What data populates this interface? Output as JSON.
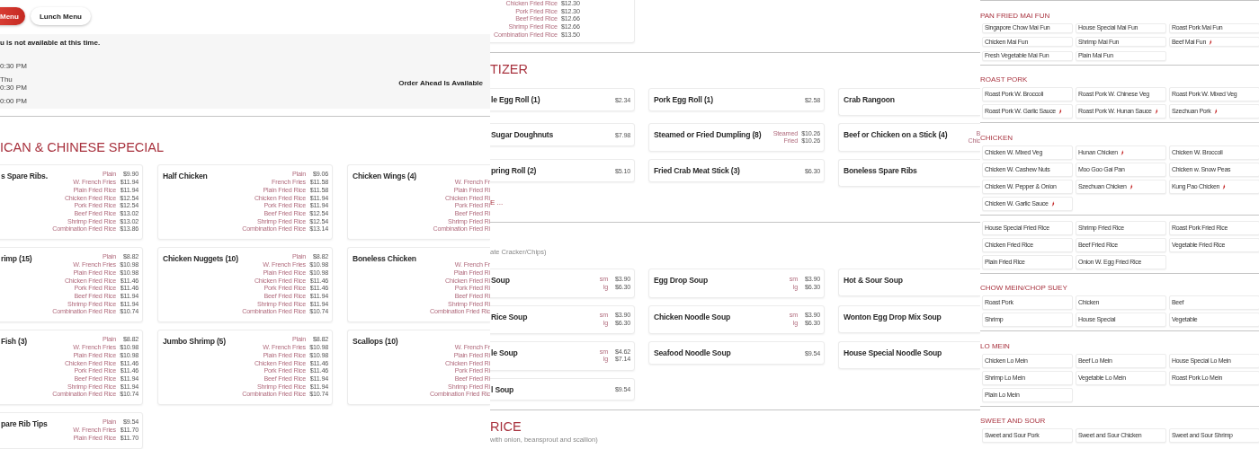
{
  "panel_1": {
    "tabs": [
      {
        "label": "Menu",
        "selected": true
      },
      {
        "label": "Lunch Menu",
        "selected": false
      }
    ],
    "notice": {
      "message": "u is not available at this time.",
      "hours": [
        [
          "0:30 PM"
        ],
        [
          "Thu",
          "0:30 PM"
        ],
        [
          "0:00 PM"
        ]
      ],
      "order_ahead": "Order Ahead Is Available"
    },
    "section": {
      "title": "ICAN & CHINESE SPECIAL",
      "items": [
        {
          "name": "s Spare Ribs.",
          "options": [
            {
              "label": "Plain",
              "price": "$9.90"
            },
            {
              "label": "W. French Fries",
              "price": "$11.94"
            },
            {
              "label": "Plain Fried Rice",
              "price": "$11.94"
            },
            {
              "label": "Chicken Fried Rice",
              "price": "$12.54"
            },
            {
              "label": "Pork Fried Rice",
              "price": "$12.54"
            },
            {
              "label": "Beef Fried Rice",
              "price": "$13.02"
            },
            {
              "label": "Shrimp Fried Rice",
              "price": "$13.02"
            },
            {
              "label": "Combination Fried Rice",
              "price": "$13.86"
            }
          ]
        },
        {
          "name": "Half Chicken",
          "options": [
            {
              "label": "Plain",
              "price": "$9.06"
            },
            {
              "label": "French Fries",
              "price": "$11.58"
            },
            {
              "label": "Plain Fried Rice",
              "price": "$11.58"
            },
            {
              "label": "Chicken Fried Rice",
              "price": "$11.94"
            },
            {
              "label": "Pork Fried Rice",
              "price": "$11.94"
            },
            {
              "label": "Beef Fried Rice",
              "price": "$12.54"
            },
            {
              "label": "Shrimp Fried Rice",
              "price": "$12.54"
            },
            {
              "label": "Combination Fried Rice",
              "price": "$13.14"
            }
          ]
        },
        {
          "name": "Chicken Wings (4)",
          "options": [
            {
              "label": "W. French Fr"
            },
            {
              "label": "Plain Fried Ri"
            },
            {
              "label": "Chicken Fried Ri"
            },
            {
              "label": "Pork Fried Ri"
            },
            {
              "label": "Beef Fried Ri"
            },
            {
              "label": "Shrimp Fried Ri"
            },
            {
              "label": "Combination Fried Ri"
            }
          ]
        },
        {
          "name": "rimp (15)",
          "options": [
            {
              "label": "Plain",
              "price": "$8.82"
            },
            {
              "label": "W. French Fries",
              "price": "$10.98"
            },
            {
              "label": "Plain Fried Rice",
              "price": "$10.98"
            },
            {
              "label": "Chicken Fried Rice",
              "price": "$11.46"
            },
            {
              "label": "Pork Fried Rice",
              "price": "$11.46"
            },
            {
              "label": "Beef Fried Rice",
              "price": "$11.94"
            },
            {
              "label": "Shrimp Fried Rice",
              "price": "$11.94"
            },
            {
              "label": "Combination Fried Rice",
              "price": "$10.74"
            }
          ]
        },
        {
          "name": "Chicken Nuggets (10)",
          "options": [
            {
              "label": "Plain",
              "price": "$8.82"
            },
            {
              "label": "W. French Fries",
              "price": "$10.98"
            },
            {
              "label": "Plain Fried Rice",
              "price": "$10.98"
            },
            {
              "label": "Chicken Fried Rice",
              "price": "$11.46"
            },
            {
              "label": "Pork Fried Rice",
              "price": "$11.46"
            },
            {
              "label": "Beef Fried Rice",
              "price": "$11.94"
            },
            {
              "label": "Shrimp Fried Rice",
              "price": "$11.94"
            },
            {
              "label": "Combination Fried Rice",
              "price": "$10.74"
            }
          ]
        },
        {
          "name": "Boneless Chicken",
          "options": [
            {
              "label": "W. French Fr"
            },
            {
              "label": "Plain Fried Ri"
            },
            {
              "label": "Chicken Fried Ri"
            },
            {
              "label": "Pork Fried Ri"
            },
            {
              "label": "Beef Fried Ri"
            },
            {
              "label": "Shrimp Fried Ri"
            },
            {
              "label": "Combination Fried Ric"
            }
          ]
        },
        {
          "name": "Fish (3)",
          "options": [
            {
              "label": "Plain",
              "price": "$8.82"
            },
            {
              "label": "W. French Fries",
              "price": "$10.98"
            },
            {
              "label": "Plain Fried Rice",
              "price": "$10.98"
            },
            {
              "label": "Chicken Fried Rice",
              "price": "$11.46"
            },
            {
              "label": "Pork Fried Rice",
              "price": "$11.46"
            },
            {
              "label": "Beef Fried Rice",
              "price": "$11.94"
            },
            {
              "label": "Shrimp Fried Rice",
              "price": "$11.94"
            },
            {
              "label": "Combination Fried Rice",
              "price": "$10.74"
            }
          ]
        },
        {
          "name": "Jumbo Shrimp (5)",
          "options": [
            {
              "label": "Plain",
              "price": "$8.82"
            },
            {
              "label": "W. French Fries",
              "price": "$10.98"
            },
            {
              "label": "Plain Fried Rice",
              "price": "$10.98"
            },
            {
              "label": "Chicken Fried Rice",
              "price": "$11.46"
            },
            {
              "label": "Pork Fried Rice",
              "price": "$11.46"
            },
            {
              "label": "Beef Fried Rice",
              "price": "$11.94"
            },
            {
              "label": "Shrimp Fried Rice",
              "price": "$11.94"
            },
            {
              "label": "Combination Fried Rice",
              "price": "$10.74"
            }
          ]
        },
        {
          "name": "Scallops (10)",
          "options": [
            {
              "label": "W. French Fr"
            },
            {
              "label": "Plain Fried Ri"
            },
            {
              "label": "Chicken Fried Ri"
            },
            {
              "label": "Pork Fried Ri"
            },
            {
              "label": "Beef Fried Ri"
            },
            {
              "label": "Shrimp Fried Ri"
            },
            {
              "label": "Combination Fried Ric"
            }
          ]
        },
        {
          "name": "pare Rib Tips",
          "options": [
            {
              "label": "Plain",
              "price": "$9.54"
            },
            {
              "label": "W. French Fries",
              "price": "$11.70"
            },
            {
              "label": "Plain Fried Rice",
              "price": "$11.70"
            }
          ]
        }
      ]
    }
  },
  "panel_2": {
    "top_card": {
      "options": [
        {
          "label": "Chicken Fried Rice",
          "price": "$12.30"
        },
        {
          "label": "Pork Fried Rice",
          "price": "$12.30"
        },
        {
          "label": "Beef Fried Rice",
          "price": "$12.66"
        },
        {
          "label": "Shrimp Fried Rice",
          "price": "$12.66"
        },
        {
          "label": "Combination Fried Rice",
          "price": "$13.50"
        }
      ]
    },
    "sections": [
      {
        "title": "TIZER",
        "items": [
          {
            "name": "le Egg Roll (1)",
            "price": "$2.34"
          },
          {
            "name": "Pork Egg Roll (1)",
            "price": "$2.58"
          },
          {
            "name": "Crab Rangoon"
          },
          {
            "name": "Sugar Doughnuts",
            "price": "$7.98"
          },
          {
            "name": "Steamed or Fried Dumpling (8)",
            "options": [
              {
                "label": "Steamed",
                "price": "$10.26"
              },
              {
                "label": "Fried",
                "price": "$10.26"
              }
            ]
          },
          {
            "name": "Beef or Chicken on a Stick (4)",
            "options": [
              {
                "label": "B"
              },
              {
                "label": "Chic"
              }
            ]
          },
          {
            "name": "pring Roll (2)",
            "price": "$5.10"
          },
          {
            "name": "Fried Crab Meat Stick (3)",
            "price": "$6.30"
          },
          {
            "name": "Boneless Spare Ribs"
          }
        ],
        "more_link": "E ..."
      },
      {
        "note": "ate Cracker/Chips)",
        "items": [
          {
            "name": "Soup",
            "options": [
              {
                "label": "sm",
                "price": "$3.90"
              },
              {
                "label": "lg",
                "price": "$6.30"
              }
            ]
          },
          {
            "name": "Egg Drop Soup",
            "options": [
              {
                "label": "sm",
                "price": "$3.90"
              },
              {
                "label": "lg",
                "price": "$6.30"
              }
            ]
          },
          {
            "name": "Hot & Sour Soup"
          },
          {
            "name": "Rice Soup",
            "options": [
              {
                "label": "sm",
                "price": "$3.90"
              },
              {
                "label": "lg",
                "price": "$6.30"
              }
            ]
          },
          {
            "name": "Chicken Noodle Soup",
            "options": [
              {
                "label": "sm",
                "price": "$3.90"
              },
              {
                "label": "lg",
                "price": "$6.30"
              }
            ]
          },
          {
            "name": "Wonton Egg Drop Mix Soup"
          },
          {
            "name": "le Soup",
            "options": [
              {
                "label": "sm",
                "price": "$4.62"
              },
              {
                "label": "lg",
                "price": "$7.14"
              }
            ]
          },
          {
            "name": "Seafood Noodle Soup",
            "price": "$9.54"
          },
          {
            "name": "House Special Noodle Soup"
          },
          {
            "name": "l Soup",
            "price": "$9.54"
          }
        ]
      },
      {
        "title": "RICE",
        "note": "with onion, beansprout and scallion)"
      }
    ]
  },
  "panel_3": {
    "sections": [
      {
        "title": "PAN FRIED MAI FUN",
        "items": [
          {
            "name": "Singapore Chow Mai Fun",
            "spicy": false
          },
          {
            "name": "House Special Mai Fun",
            "spicy": false
          },
          {
            "name": "Roast Pork Mai Fun",
            "spicy": false
          },
          {
            "name": "Chicken Mai Fun",
            "spicy": false
          },
          {
            "name": "Shrimp Mai Fun",
            "spicy": false
          },
          {
            "name": "Beef Mai Fun",
            "spicy": true
          },
          {
            "name": "Fresh Vegetable Mai Fun",
            "spicy": false
          },
          {
            "name": "Plain Mai Fun",
            "spicy": false
          }
        ]
      },
      {
        "title": "ROAST PORK",
        "items": [
          {
            "name": "Roast Pork W. Broccoli",
            "spicy": false
          },
          {
            "name": "Roast Pork W. Chinese Veg",
            "spicy": false
          },
          {
            "name": "Roast Pork W. Mixed Veg",
            "spicy": false
          },
          {
            "name": "Roast Pork W. Garlic Sauce",
            "spicy": true
          },
          {
            "name": "Roast Pork W. Hunan Sauce",
            "spicy": true
          },
          {
            "name": "Szechuan Pork",
            "spicy": true
          }
        ]
      },
      {
        "title": "CHICKEN",
        "items": [
          {
            "name": "Chicken W. Mixed Veg",
            "spicy": false
          },
          {
            "name": "Hunan Chicken",
            "spicy": true
          },
          {
            "name": "Chicken W. Broccoli",
            "spicy": false
          },
          {
            "name": "Chicken W. Cashew Nuts",
            "spicy": false
          },
          {
            "name": "Moo Goo Gai Pan",
            "spicy": false
          },
          {
            "name": "Chicken w. Snow Peas",
            "spicy": false
          },
          {
            "name": "Chicken W. Pepper & Onion",
            "spicy": false
          },
          {
            "name": "Szechuan Chicken",
            "spicy": true
          },
          {
            "name": "Kung Pao Chicken",
            "spicy": true
          },
          {
            "name": "Chicken W. Garlic Sauce",
            "spicy": true
          }
        ]
      },
      {
        "items": [
          {
            "name": "House Special Fried Rice",
            "spicy": false
          },
          {
            "name": "Shrimp Fried Rice",
            "spicy": false
          },
          {
            "name": "Roast Pork Fried Rice",
            "spicy": false
          },
          {
            "name": "Chicken Fried Rice",
            "spicy": false
          },
          {
            "name": "Beef Fried Rice",
            "spicy": false
          },
          {
            "name": "Vegetable Fried Rice",
            "spicy": false
          },
          {
            "name": "Plain Fried Rice",
            "spicy": false
          },
          {
            "name": "Onion W. Egg Fried Rice",
            "spicy": false
          }
        ]
      },
      {
        "title": "CHOW MEIN/CHOP SUEY",
        "items": [
          {
            "name": "Roast Pork",
            "spicy": false
          },
          {
            "name": "Chicken",
            "spicy": false
          },
          {
            "name": "Beef",
            "spicy": false
          },
          {
            "name": "Shrimp",
            "spicy": false
          },
          {
            "name": "House Special",
            "spicy": false
          },
          {
            "name": "Vegetable",
            "spicy": false
          }
        ]
      },
      {
        "title": "LO MEIN",
        "items": [
          {
            "name": "Chicken Lo Mein",
            "spicy": false
          },
          {
            "name": "Beef Lo Mein",
            "spicy": false
          },
          {
            "name": "House Special Lo Mein",
            "spicy": false
          },
          {
            "name": "Shrimp Lo Mein",
            "spicy": false
          },
          {
            "name": "Vegetable Lo Mein",
            "spicy": false
          },
          {
            "name": "Roast Pork Lo Mein",
            "spicy": false
          },
          {
            "name": "Plain Lo Mein",
            "spicy": false
          }
        ]
      },
      {
        "title": "SWEET AND SOUR",
        "items": [
          {
            "name": "Sweet and Sour Pork",
            "spicy": false
          },
          {
            "name": "Sweet and Sour Chicken",
            "spicy": false
          },
          {
            "name": "Sweet and Sour Shrimp",
            "spicy": false
          }
        ]
      }
    ]
  }
}
